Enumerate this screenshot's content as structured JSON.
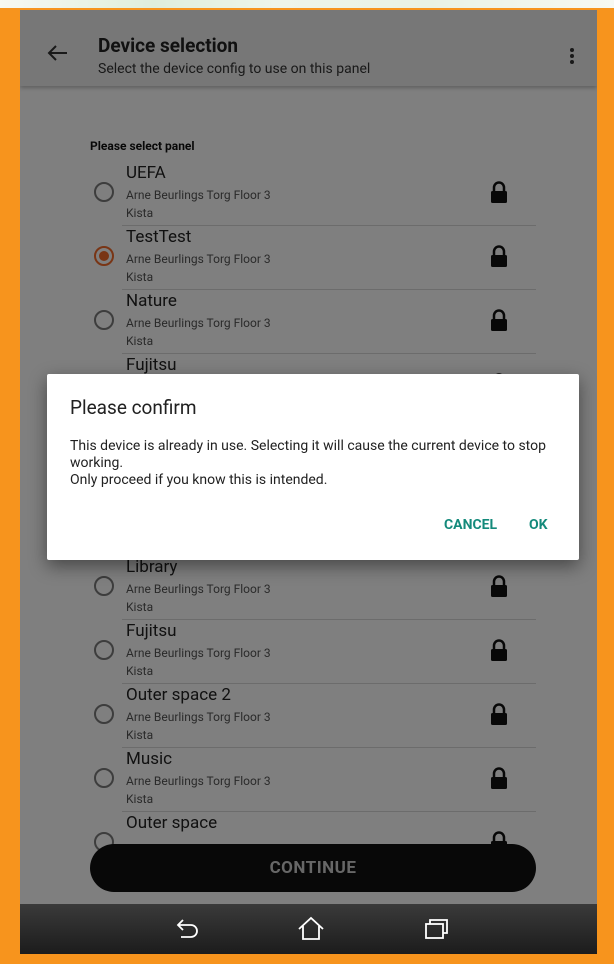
{
  "appbar": {
    "title": "Device selection",
    "subtitle": "Select the device config to use on this panel",
    "back_icon": "arrow-back-icon",
    "menu_icon": "more-vert-icon"
  },
  "list": {
    "header": "Please select panel",
    "items": [
      {
        "name": "UEFA",
        "address": "Arne Beurlings Torg  Floor 3",
        "city": "Kista",
        "selected": false,
        "locked": true
      },
      {
        "name": "TestTest",
        "address": "Arne Beurlings Torg  Floor 3",
        "city": "Kista",
        "selected": true,
        "locked": true
      },
      {
        "name": "Nature",
        "address": "Arne Beurlings Torg  Floor 3",
        "city": "Kista",
        "selected": false,
        "locked": true
      },
      {
        "name": "Fujitsu",
        "address": "",
        "city": "",
        "selected": false,
        "locked": true
      },
      {
        "name": "Library",
        "address": "Arne Beurlings Torg  Floor 3",
        "city": "Kista",
        "selected": false,
        "locked": true
      },
      {
        "name": "Fujitsu",
        "address": "Arne Beurlings Torg  Floor 3",
        "city": "Kista",
        "selected": false,
        "locked": true
      },
      {
        "name": "Outer space 2",
        "address": "Arne Beurlings Torg  Floor 3",
        "city": "Kista",
        "selected": false,
        "locked": true
      },
      {
        "name": "Music",
        "address": "Arne Beurlings Torg  Floor 3",
        "city": "Kista",
        "selected": false,
        "locked": true
      },
      {
        "name": "Outer space",
        "address": "",
        "city": "",
        "selected": false,
        "locked": true
      }
    ]
  },
  "continue_label": "CONTINUE",
  "dialog": {
    "title": "Please confirm",
    "message_line1": "This device is already in use. Selecting it will cause the current device to stop working.",
    "message_line2": "Only proceed if you know this is intended.",
    "cancel_label": "CANCEL",
    "ok_label": "OK",
    "accent_color": "#148a7b"
  },
  "navbar": {
    "back_icon": "nav-back-icon",
    "home_icon": "nav-home-icon",
    "recents_icon": "nav-recents-icon"
  },
  "colors": {
    "frame": "#f7941d",
    "radio_selected": "#f26a2a",
    "button_bg": "#111111"
  }
}
